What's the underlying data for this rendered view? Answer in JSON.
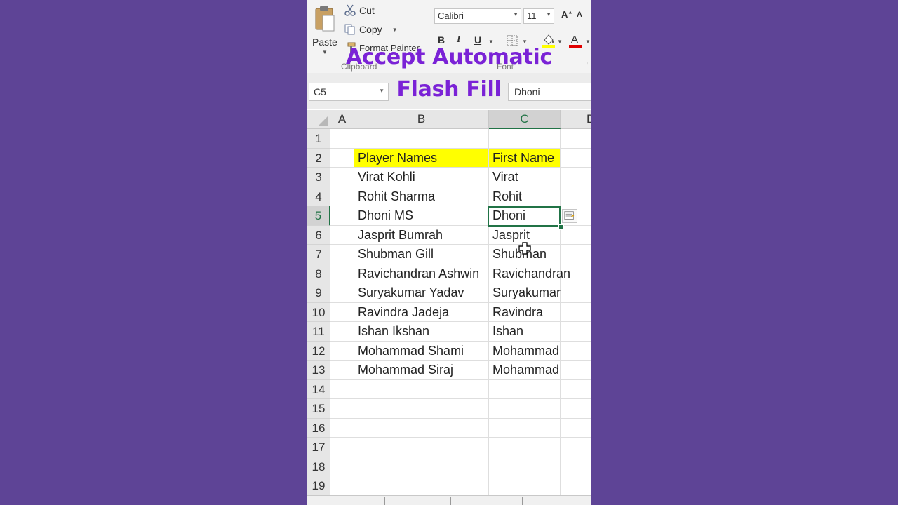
{
  "ribbon": {
    "paste_label": "Paste",
    "cut_label": "Cut",
    "copy_label": "Copy",
    "format_painter_label": "Format Painter",
    "clipboard_group": "Clipboard",
    "font_group": "Font",
    "font_name": "Calibri",
    "font_size": "11",
    "bold": "B",
    "italic": "I",
    "underline": "U"
  },
  "overlay": {
    "line1": "Accept Automatic",
    "line2": "Flash Fill"
  },
  "formula_bar": {
    "name_box": "C5",
    "value": "Dhoni"
  },
  "columns": [
    "A",
    "B",
    "C",
    "D"
  ],
  "rows": [
    {
      "num": "1",
      "b": "",
      "c": ""
    },
    {
      "num": "2",
      "b": "Player Names",
      "c": "First Name"
    },
    {
      "num": "3",
      "b": "Virat Kohli",
      "c": "Virat"
    },
    {
      "num": "4",
      "b": "Rohit Sharma",
      "c": "Rohit"
    },
    {
      "num": "5",
      "b": "Dhoni MS",
      "c": "Dhoni"
    },
    {
      "num": "6",
      "b": "Jasprit Bumrah",
      "c": "Jasprit"
    },
    {
      "num": "7",
      "b": "Shubman Gill",
      "c": "Shubman"
    },
    {
      "num": "8",
      "b": "Ravichandran Ashwin",
      "c": "Ravichandran"
    },
    {
      "num": "9",
      "b": "Suryakumar Yadav",
      "c": "Suryakumar"
    },
    {
      "num": "10",
      "b": "Ravindra Jadeja",
      "c": "Ravindra"
    },
    {
      "num": "11",
      "b": "Ishan Ikshan",
      "c": "Ishan"
    },
    {
      "num": "12",
      "b": "Mohammad Shami",
      "c": "Mohammad"
    },
    {
      "num": "13",
      "b": "Mohammad Siraj",
      "c": "Mohammad"
    },
    {
      "num": "14",
      "b": "",
      "c": ""
    },
    {
      "num": "15",
      "b": "",
      "c": ""
    },
    {
      "num": "16",
      "b": "",
      "c": ""
    },
    {
      "num": "17",
      "b": "",
      "c": ""
    },
    {
      "num": "18",
      "b": "",
      "c": ""
    },
    {
      "num": "19",
      "b": "",
      "c": ""
    }
  ],
  "active_cell": {
    "column": "C",
    "row": "5"
  },
  "colors": {
    "background": "#5e4496",
    "overlay_text": "#7a22d6",
    "header_highlight": "#ffff00",
    "excel_green": "#217346"
  }
}
